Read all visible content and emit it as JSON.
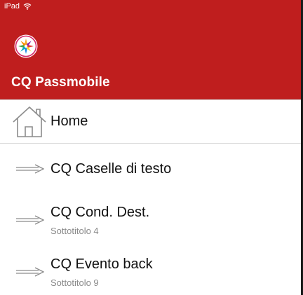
{
  "status_bar": {
    "device": "iPad",
    "wifi_icon": "wifi-icon"
  },
  "header": {
    "background_color": "#bf1e1e",
    "logo_icon": "app-logo-icon",
    "title": "CQ Passmobile"
  },
  "menu": {
    "home": {
      "icon": "home-icon",
      "label": "Home"
    },
    "items": [
      {
        "icon": "arrow-right-icon",
        "label": "CQ Caselle di testo",
        "subtitle": ""
      },
      {
        "icon": "arrow-right-icon",
        "label": "CQ Cond. Dest.",
        "subtitle": "Sottotitolo 4"
      },
      {
        "icon": "arrow-right-icon",
        "label": "CQ Evento back",
        "subtitle": "Sottotitolo 9"
      }
    ]
  }
}
